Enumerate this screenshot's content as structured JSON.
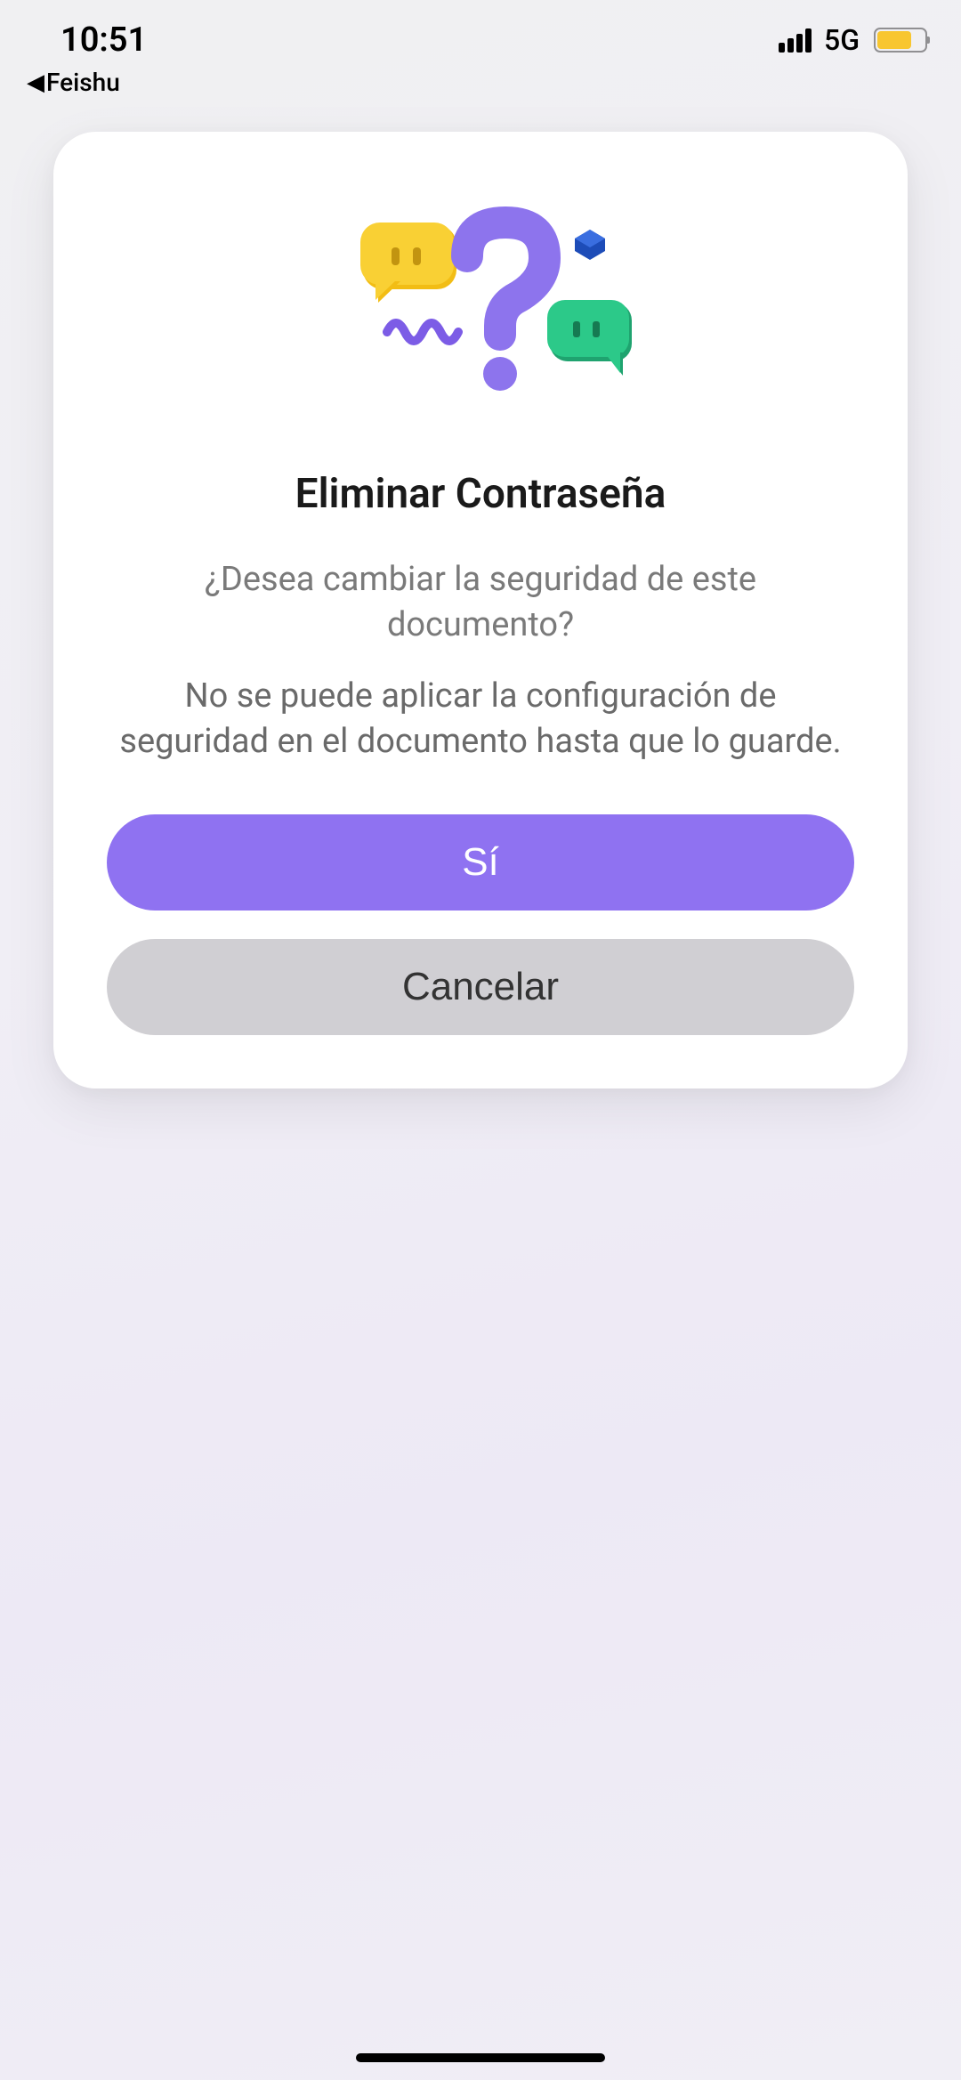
{
  "status_bar": {
    "time": "10:51",
    "network_type": "5G"
  },
  "back_nav": {
    "label": "Feishu"
  },
  "dialog": {
    "title": "Eliminar Contraseña",
    "subtitle": "¿Desea cambiar la seguridad de este documento?",
    "description": "No se puede aplicar la configuración de seguridad en el documento hasta que lo guarde.",
    "confirm_label": "Sí",
    "cancel_label": "Cancelar"
  }
}
